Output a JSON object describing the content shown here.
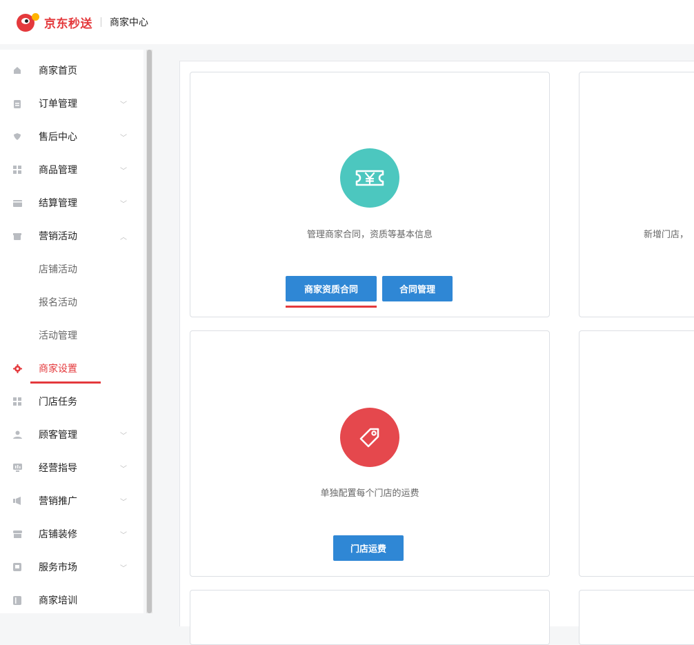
{
  "header": {
    "brand": "京东秒送",
    "title": "商家中心"
  },
  "sidebar": {
    "items": [
      {
        "label": "商家首页",
        "icon": "home-icon"
      },
      {
        "label": "订单管理",
        "icon": "clipboard-icon",
        "chevron": "﹀"
      },
      {
        "label": "售后中心",
        "icon": "shield-icon",
        "chevron": "﹀"
      },
      {
        "label": "商品管理",
        "icon": "grid-icon",
        "chevron": "﹀"
      },
      {
        "label": "结算管理",
        "icon": "wallet-icon",
        "chevron": "﹀"
      },
      {
        "label": "营销活动",
        "icon": "gift-icon",
        "chevron": "︿"
      },
      {
        "label": "店铺活动"
      },
      {
        "label": "报名活动"
      },
      {
        "label": "活动管理"
      },
      {
        "label": "商家设置",
        "icon": "gear-icon"
      },
      {
        "label": "门店任务",
        "icon": "apps-icon"
      },
      {
        "label": "顾客管理",
        "icon": "users-icon",
        "chevron": "﹀"
      },
      {
        "label": "经营指导",
        "icon": "chart-icon",
        "chevron": "﹀"
      },
      {
        "label": "营销推广",
        "icon": "megaphone-icon",
        "chevron": "﹀"
      },
      {
        "label": "店铺装修",
        "icon": "store-icon",
        "chevron": "﹀"
      },
      {
        "label": "服务市场",
        "icon": "badge-icon",
        "chevron": "﹀"
      },
      {
        "label": "商家培训",
        "icon": "book-icon"
      }
    ]
  },
  "cards": {
    "contract": {
      "icon": "coupon-yen-icon",
      "icon_color": "#4cc7bf",
      "desc": "管理商家合同，资质等基本信息",
      "btn1": "商家资质合同",
      "btn2": "合同管理"
    },
    "store": {
      "desc_partial": "新增门店，"
    },
    "freight": {
      "icon": "tag-icon",
      "icon_color": "#e5484d",
      "desc": "单独配置每个门店的运费",
      "btn1": "门店运费"
    }
  }
}
